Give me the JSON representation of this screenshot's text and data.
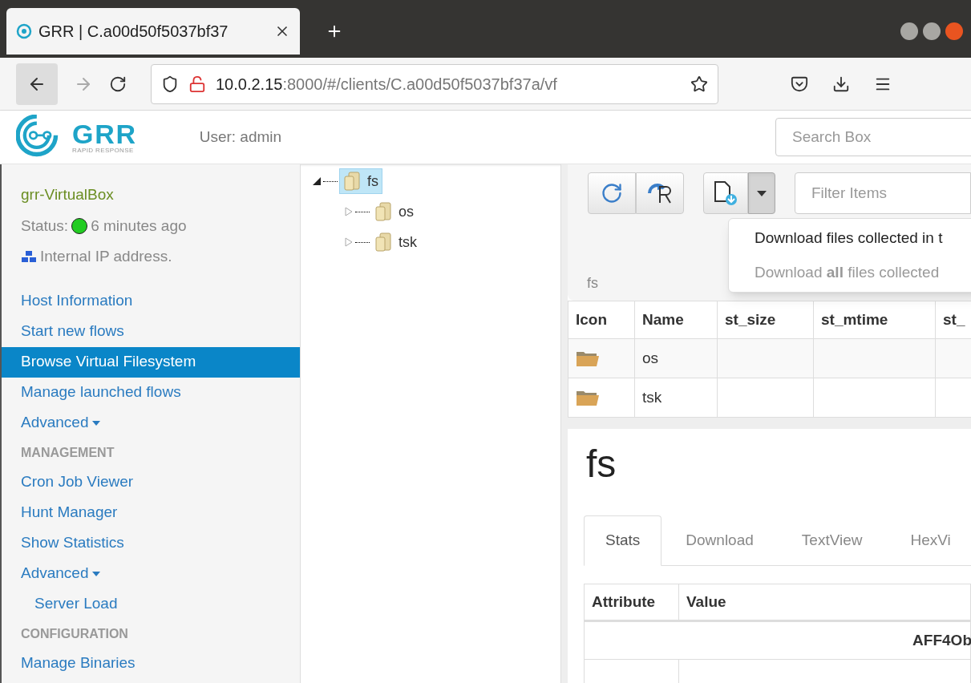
{
  "browser": {
    "tab_title": "GRR | C.a00d50f5037bf37",
    "url_host": "10.0.2.15",
    "url_rest": ":8000/#/clients/C.a00d50f5037bf37a/vf"
  },
  "header": {
    "logo_text": "GRR",
    "logo_subtitle": "RAPID RESPONSE",
    "user": "User: admin",
    "search": {
      "placeholder": "Search Box"
    }
  },
  "client": {
    "hostname": "grr-VirtualBox",
    "status_label": "Status:",
    "online": true,
    "last_seen": "6 minutes ago",
    "ip_note": "Internal IP address."
  },
  "sidebar": {
    "items": [
      {
        "kind": "link",
        "label": "Host Information",
        "selected": false
      },
      {
        "kind": "link",
        "label": "Start new flows",
        "selected": false
      },
      {
        "kind": "link",
        "label": "Browse Virtual Filesystem",
        "selected": true
      },
      {
        "kind": "link",
        "label": "Manage launched flows",
        "selected": false
      },
      {
        "kind": "dropdown",
        "label": "Advanced",
        "selected": false
      },
      {
        "kind": "header",
        "label": "MANAGEMENT"
      },
      {
        "kind": "link",
        "label": "Cron Job Viewer",
        "selected": false
      },
      {
        "kind": "link",
        "label": "Hunt Manager",
        "selected": false
      },
      {
        "kind": "link",
        "label": "Show Statistics",
        "selected": false
      },
      {
        "kind": "dropdown",
        "label": "Advanced",
        "selected": false
      },
      {
        "kind": "sub",
        "label": "Server Load",
        "selected": false
      },
      {
        "kind": "header",
        "label": "CONFIGURATION"
      },
      {
        "kind": "link",
        "label": "Manage Binaries",
        "selected": false
      }
    ]
  },
  "tree": [
    {
      "label": "fs",
      "expanded": true,
      "selected": true,
      "children": [
        {
          "label": "os",
          "expanded": false,
          "selected": false
        },
        {
          "label": "tsk",
          "expanded": false,
          "selected": false
        }
      ]
    }
  ],
  "toolbar": {
    "filter": {
      "placeholder": "Filter Items"
    },
    "download_menu": {
      "open": true,
      "items": [
        {
          "label": "Download files collected in t",
          "disabled": false
        },
        {
          "label": "Download **all** files collected",
          "disabled": true
        }
      ]
    }
  },
  "breadcrumb": "fs",
  "table": {
    "columns": [
      "Icon",
      "Name",
      "st_size",
      "st_mtime",
      "st_"
    ],
    "rows": [
      {
        "name": "os"
      },
      {
        "name": "tsk"
      }
    ]
  },
  "details": {
    "title": "fs",
    "tabs": [
      {
        "label": "Stats",
        "selected": true
      },
      {
        "label": "Download",
        "selected": false
      },
      {
        "label": "TextView",
        "selected": false
      },
      {
        "label": "HexVi",
        "selected": false
      }
    ],
    "table": {
      "columns": [
        "Attribute",
        "Value"
      ],
      "section": "AFF4Ob"
    }
  }
}
